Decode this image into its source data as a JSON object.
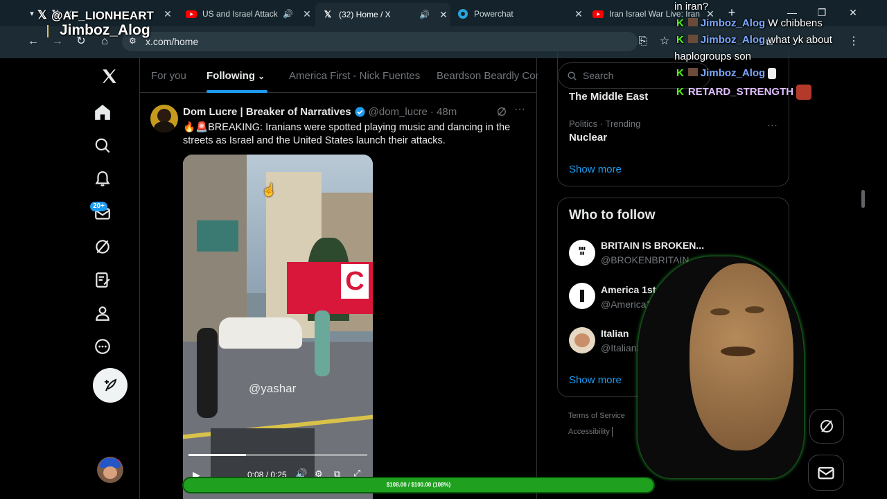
{
  "browser": {
    "tabs": [
      {
        "label": "X",
        "audio": false
      },
      {
        "label": "US and Israel Attack",
        "audio": true
      },
      {
        "label": "(32) Home / X",
        "audio": true
      },
      {
        "label": "Powerchat",
        "audio": false
      },
      {
        "label": "Iran Israel War Live: Iran",
        "audio": false
      }
    ],
    "url": "x.com/home"
  },
  "nav": {
    "messages_badge": "20+"
  },
  "feed": {
    "tabs": [
      "For you",
      "Following",
      "America First - Nick Fuentes",
      "Beardson Beardly Com"
    ],
    "active_tab": "Following",
    "post": {
      "author": "Dom Lucre | Breaker of Narratives",
      "handle": "@dom_lucre",
      "time": "· 48m",
      "text_line1": "BREAKING: Iranians were spotted playing music and dancing in the",
      "text_line2": "streets as Israel and the United States launch their attacks.",
      "video_watermark": "@yashar",
      "video_time": "0:08 / 0:25",
      "progress_fraction": 0.32
    }
  },
  "sidebar": {
    "search_placeholder": "Search",
    "trends": [
      {
        "meta": "",
        "name": "The Middle East"
      },
      {
        "meta": "Politics · Trending",
        "name": "Nuclear"
      }
    ],
    "show_more": "Show more",
    "who_to_follow_title": "Who to follow",
    "follow_suggestions": [
      {
        "name": "BRITAIN IS BROKEN...",
        "handle": "@BROKENBRITAIN"
      },
      {
        "name": "America 1st",
        "handle": "@America1s"
      },
      {
        "name": "Italian",
        "handle": "@Italian3"
      }
    ],
    "show_more_2": "Show more",
    "footer": [
      "Terms of Service",
      "Accessibility"
    ]
  },
  "stream_overlay": {
    "top_name": "@AF_LIONHEART",
    "sub_name": "Jimboz_Alog",
    "chat": [
      {
        "user": "",
        "text": "in iran?"
      },
      {
        "user": "Jimboz_Alog",
        "text": "W chibbens"
      },
      {
        "user": "Jimboz_Alog",
        "text": "what yk about"
      },
      {
        "user": "",
        "text": "haplogroups son"
      },
      {
        "user": "Jimboz_Alog",
        "text": ""
      },
      {
        "user": "RETARD_STRENGTH",
        "text": ""
      }
    ],
    "donation": "$108.00 / $100.00 (108%)",
    "donation_fraction": 1.0
  },
  "colors": {
    "accent": "#1d9bf0",
    "kick_green": "#53fc18",
    "donation_green": "#1fa11f",
    "bg": "#000000"
  }
}
